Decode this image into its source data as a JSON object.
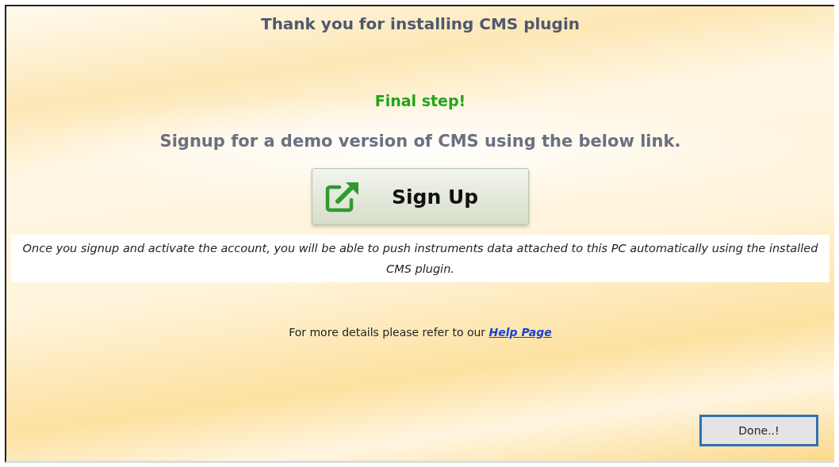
{
  "title": "Thank you for installing CMS plugin",
  "step": "Final step!",
  "instruction": "Signup for a demo version of CMS using the below link.",
  "signup_button": {
    "label": "Sign Up"
  },
  "note": "Once you signup and activate the account, you will be able to push instruments data attached to this PC automatically using the installed CMS plugin.",
  "help": {
    "text": "For more details please refer to our",
    "link": "Help Page"
  },
  "done_button": {
    "label": "Done..!"
  }
}
